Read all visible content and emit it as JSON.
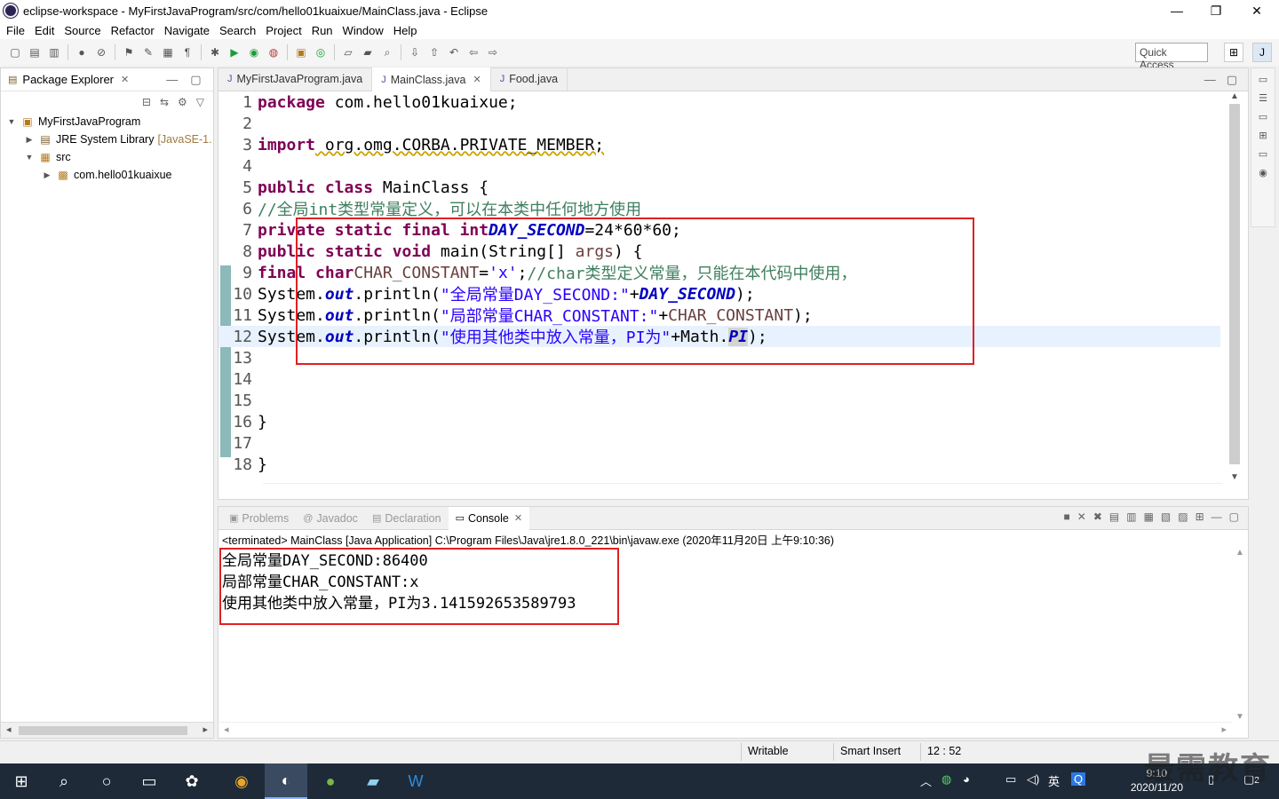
{
  "window": {
    "title": "eclipse-workspace - MyFirstJavaProgram/src/com/hello01kuaixue/MainClass.java - Eclipse",
    "controls": [
      "—",
      "❐",
      "✕"
    ]
  },
  "menu": [
    "File",
    "Edit",
    "Source",
    "Refactor",
    "Navigate",
    "Search",
    "Project",
    "Run",
    "Window",
    "Help"
  ],
  "toolbar": {
    "quick_access": "Quick Access"
  },
  "package_explorer": {
    "title": "Package Explorer",
    "tree": [
      {
        "label": "MyFirstJavaProgram",
        "detail": ""
      },
      {
        "label": "JRE System Library",
        "detail": "[JavaSE-1."
      },
      {
        "label": "src",
        "detail": ""
      },
      {
        "label": "com.hello01kuaixue",
        "detail": ""
      }
    ]
  },
  "editor": {
    "tabs": [
      {
        "label": "MyFirstJavaProgram.java"
      },
      {
        "label": "MainClass.java"
      },
      {
        "label": "Food.java"
      }
    ],
    "lines": [
      "1",
      "2",
      "3",
      "4",
      "5",
      "6",
      "7",
      "8",
      "9",
      "10",
      "11",
      "12",
      "13",
      "14",
      "15",
      "16",
      "17",
      "18"
    ],
    "code": {
      "l1": {
        "kw": "package",
        "rest": " com.hello01kuaixue;"
      },
      "l3": {
        "kw": "import",
        "rest": " org.omg.CORBA.PRIVATE_MEMBER;"
      },
      "l5": {
        "kw": "public class",
        "rest": " MainClass {"
      },
      "l6": {
        "comment": "//全局int类型常量定义，可以在本类中任何地方使用"
      },
      "l7": {
        "kw": "private static final int",
        "const": "DAY_SECOND",
        "rest": "=24*60*60;"
      },
      "l8": {
        "kw": "public static void",
        "rest_a": " main(String[] ",
        "var": "args",
        "rest_b": ") {"
      },
      "l9": {
        "kw": "final char",
        "var": "CHAR_CONSTANT",
        "eq": "=",
        "str": "'x'",
        "semi": ";",
        "comment": "//char类型定义常量，只能在本代码中使用，"
      },
      "l10": {
        "a": "System.",
        "out": "out",
        "b": ".println(",
        "str": "\"全局常量DAY_SECOND:\"",
        "plus": "+",
        "const": "DAY_SECOND",
        "end": ");"
      },
      "l11": {
        "a": "System.",
        "out": "out",
        "b": ".println(",
        "str": "\"局部常量CHAR_CONSTANT:\"",
        "plus": "+",
        "var": "CHAR_CONSTANT",
        "end": ");"
      },
      "l12": {
        "a": "System.",
        "out": "out",
        "b": ".println(",
        "str": "\"使用其他类中放入常量，PI为\"",
        "plus": "+Math.",
        "const": "PI",
        "end": ");"
      },
      "l16": {
        "rest": "}"
      },
      "l18": {
        "rest": "}"
      }
    }
  },
  "console": {
    "tabs": [
      "Problems",
      "Javadoc",
      "Declaration",
      "Console"
    ],
    "terminated": "<terminated> MainClass [Java Application] C:\\Program Files\\Java\\jre1.8.0_221\\bin\\javaw.exe (2020年11月20日 上午9:10:36)",
    "output": [
      "全局常量DAY_SECOND:86400",
      "局部常量CHAR_CONSTANT:x",
      "使用其他类中放入常量，PI为3.141592653589793"
    ]
  },
  "status": {
    "writable": "Writable",
    "insert": "Smart Insert",
    "position": "12 : 52"
  },
  "taskbar": {
    "time": "9:10",
    "date": "2020/11/20",
    "ime": "英",
    "notif": "2"
  },
  "watermark": "最需教育",
  "colors": {
    "keyword": "#7f0055",
    "constant": "#0000c0",
    "string": "#2a00ff",
    "comment": "#3f7f5f",
    "highlight_box": "#e02020"
  }
}
